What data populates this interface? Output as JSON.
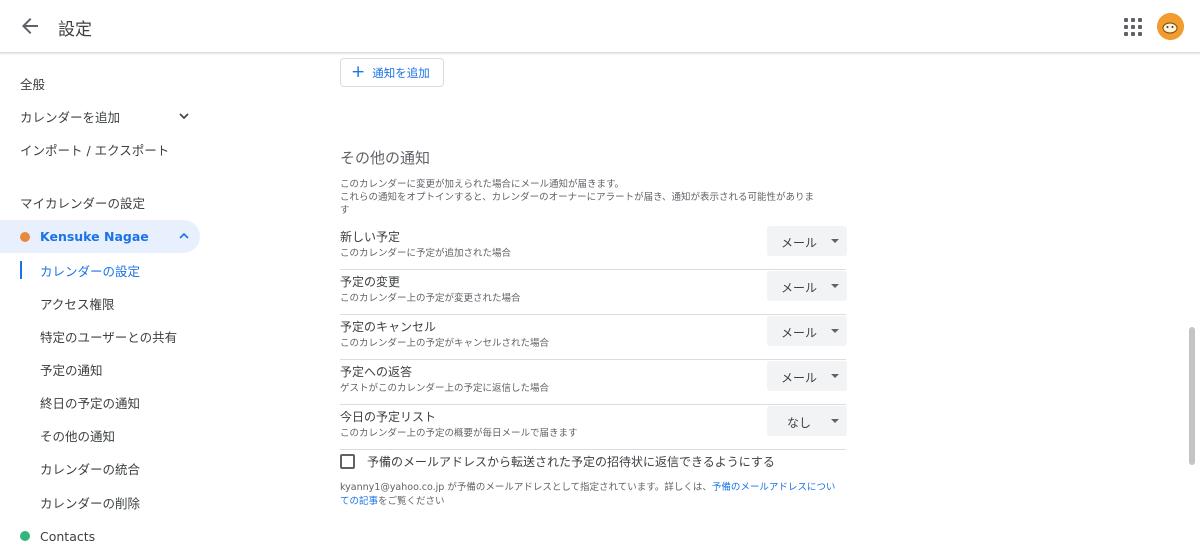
{
  "header": {
    "title": "設定"
  },
  "sidebar": {
    "top_items": [
      "全般",
      "カレンダーを追加",
      "インポート / エクスポート"
    ],
    "my_calendars_heading": "マイカレンダーの設定",
    "calendar": {
      "name": "Kensuke Nagae",
      "color": "#e8893d"
    },
    "sub_items": [
      "カレンダーの設定",
      "アクセス権限",
      "特定のユーザーとの共有",
      "予定の通知",
      "終日の予定の通知",
      "その他の通知",
      "カレンダーの統合",
      "カレンダーの削除"
    ],
    "contacts": {
      "name": "Contacts",
      "color": "#33b679"
    }
  },
  "main": {
    "add_notification_label": "通知を追加",
    "other_notifications": {
      "title": "その他の通知",
      "desc_line1": "このカレンダーに変更が加えられた場合にメール通知が届きます。",
      "desc_line2": "これらの通知をオプトインすると、カレンダーのオーナーにアラートが届き、通知が表示される可能性がありま",
      "desc_line3": "す",
      "rows": [
        {
          "title": "新しい予定",
          "sub": "このカレンダーに予定が追加された場合",
          "value": "メール"
        },
        {
          "title": "予定の変更",
          "sub": "このカレンダー上の予定が変更された場合",
          "value": "メール"
        },
        {
          "title": "予定のキャンセル",
          "sub": "このカレンダー上の予定がキャンセルされた場合",
          "value": "メール"
        },
        {
          "title": "予定への返答",
          "sub": "ゲストがこのカレンダー上の予定に返信した場合",
          "value": "メール"
        },
        {
          "title": "今日の予定リスト",
          "sub": "このカレンダー上の予定の概要が毎日メールで届きます",
          "value": "なし"
        }
      ]
    },
    "reply_checkbox_label": "予備のメールアドレスから転送された予定の招待状に返信できるようにする",
    "footnote": {
      "text": "kyanny1@yahoo.co.jp が予備のメールアドレスとして指定されています。詳しくは、",
      "link1": "予備のメールアドレスについ",
      "link2": "ての記事",
      "tail": "をご覧ください"
    }
  },
  "colors": {
    "accent": "#1a73e8",
    "selected_bg": "#e8f0fe"
  }
}
